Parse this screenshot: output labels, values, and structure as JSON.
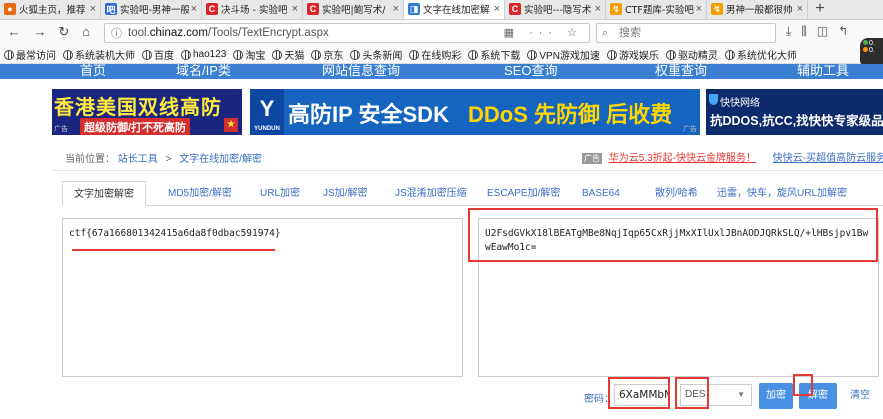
{
  "browser": {
    "tabs": [
      {
        "label": "火狐主页，推荐",
        "color": "#e86a10",
        "glyph": "●"
      },
      {
        "label": "实验吧-男神一般",
        "color": "#2f6bd6",
        "glyph": "吧"
      },
      {
        "label": "决斗场 - 实验吧",
        "color": "#d8262b",
        "glyph": "C"
      },
      {
        "label": "实验吧|鲍写术/",
        "color": "#d8262b",
        "glyph": "C"
      },
      {
        "label": "文字在线加密解",
        "color": "#2f7fd6",
        "glyph": "◨"
      },
      {
        "label": "实验吧---隐写术",
        "color": "#d8262b",
        "glyph": "C"
      },
      {
        "label": "CTF题库-实验吧",
        "color": "#f2a000",
        "glyph": "↯"
      },
      {
        "label": "男神一般都很帅",
        "color": "#f2a000",
        "glyph": "↯"
      }
    ],
    "active_tab": 4,
    "new_tab": "+",
    "url_prefix": "tool.",
    "url_domain": "chinaz.com",
    "url_path": "/Tools/TextEncrypt.aspx",
    "search_placeholder": "搜索",
    "bookmarks": [
      "最常访问",
      "系统装机大师",
      "百度",
      "hao123",
      "淘宝",
      "天猫",
      "京东",
      "头条新闻",
      "在线购彩",
      "系统下载",
      "VPN游戏加速",
      "游戏娱乐",
      "驱动精灵",
      "系统优化大师"
    ],
    "zoom_a": "0.",
    "zoom_b": "0."
  },
  "site_nav": [
    "首页",
    "域名/IP类",
    "网站信息查询",
    "SEO查询",
    "权重查询",
    "辅助工具"
  ],
  "banners": {
    "b1_title": "香港美国双线高防",
    "b1_sub": "超级防御/打不死高防",
    "b1_ad": "广告",
    "b2_logo": "Y",
    "b2_logo_small": "YUNDUN",
    "b2_title": "高防IP 安全SDK",
    "b2_title2": "DDoS 先防御 后收费",
    "b2_ad": "广告",
    "b3_brand": "快快网络",
    "b3_title": "抗DDOS,抗CC,找快快专家级品牌"
  },
  "breadcrumb": {
    "prefix": "当前位置：",
    "root": "站长工具",
    "sep": ">",
    "current": "文字在线加密/解密"
  },
  "promo": {
    "tag": "广告",
    "red_link": "华为云5.3折起-快快云金牌服务！",
    "blue_link": "快快云-买超值高防云服务器！"
  },
  "tool_tabs": [
    "文字加密解密",
    "MD5加密/解密",
    "URL加密",
    "JS加/解密",
    "JS混淆加密压缩",
    "ESCAPE加/解密",
    "BASE64",
    "散列/哈希",
    "迅雷，快车，旋风URL加解密"
  ],
  "active_tool_tab": 0,
  "input_text": "ctf{67a166801342415a6da8f0dbac591974}",
  "output_text": "U2FsdGVkX18lBEATgMBe8NqjIqp65CxRjjMxXIlUxlJBnAODJQRkSLQ/+lHBsjpv1BwwEawMo1c=",
  "controls": {
    "password_label": "密码：",
    "password_value": "6XaMMbM",
    "algorithm": "DES",
    "encrypt_label": "加密",
    "decrypt_label": "解密",
    "clear_label": "清空"
  },
  "colors": {
    "highlight": "#e53935",
    "site_nav_bg": "#3a7fd1",
    "button": "#4a90e2"
  }
}
